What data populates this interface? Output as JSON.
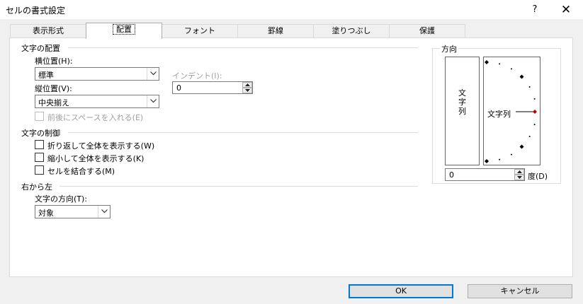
{
  "window": {
    "title": "セルの書式設定",
    "help": "?",
    "close": "✕"
  },
  "tabs": [
    {
      "label": "表示形式"
    },
    {
      "label": "配置",
      "active": true
    },
    {
      "label": "フォント"
    },
    {
      "label": "罫線"
    },
    {
      "label": "塗りつぶし"
    },
    {
      "label": "保護"
    }
  ],
  "alignment": {
    "section_label": "文字の配置",
    "horizontal_label": "横位置(H):",
    "horizontal_value": "標準",
    "indent_label": "インデント(I):",
    "indent_value": "0",
    "vertical_label": "縦位置(V):",
    "vertical_value": "中央揃え",
    "justify_distributed_label": "前後にスペースを入れる(E)"
  },
  "text_control": {
    "section_label": "文字の制御",
    "wrap_text": "折り返して全体を表示する(W)",
    "shrink_to_fit": "縮小して全体を表示する(K)",
    "merge_cells": "セルを結合する(M)"
  },
  "rtl": {
    "section_label": "右から左",
    "direction_label": "文字の方向(T):",
    "direction_value": "対象"
  },
  "orientation": {
    "legend": "方向",
    "vertical_text": "文字列",
    "dial_text": "文字列",
    "degrees_value": "0",
    "degrees_label": "度(D)",
    "marker_color": "#c00000"
  },
  "buttons": {
    "ok": "OK",
    "cancel": "キャンセル",
    "default_border_color": "#0078d7"
  }
}
